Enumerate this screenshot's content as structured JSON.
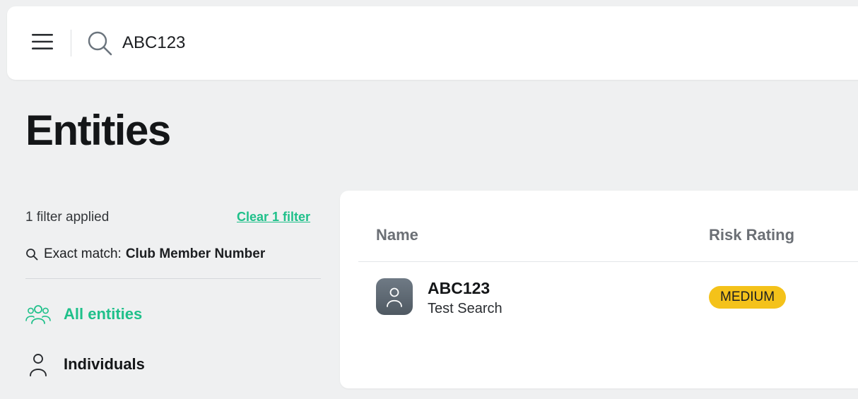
{
  "header": {
    "search_value": "ABC123",
    "icons": {
      "menu": "hamburger-menu-icon",
      "search": "search-icon"
    }
  },
  "page": {
    "title": "Entities"
  },
  "filters": {
    "applied_text": "1 filter applied",
    "clear_label": "Clear 1 filter",
    "match_label": "Exact match:",
    "match_value": "Club Member Number"
  },
  "nav": {
    "items": [
      {
        "label": "All entities",
        "icon": "people-group-icon",
        "active": true
      },
      {
        "label": "Individuals",
        "icon": "person-icon",
        "active": false
      }
    ]
  },
  "table": {
    "columns": [
      "Name",
      "Risk Rating"
    ],
    "rows": [
      {
        "name": "ABC123",
        "subtitle": "Test Search",
        "risk": "MEDIUM",
        "avatar_icon": "person-avatar-icon"
      }
    ]
  },
  "colors": {
    "accent": "#1fc08a",
    "risk_medium": "#f4c21a",
    "background": "#eff0f1"
  }
}
